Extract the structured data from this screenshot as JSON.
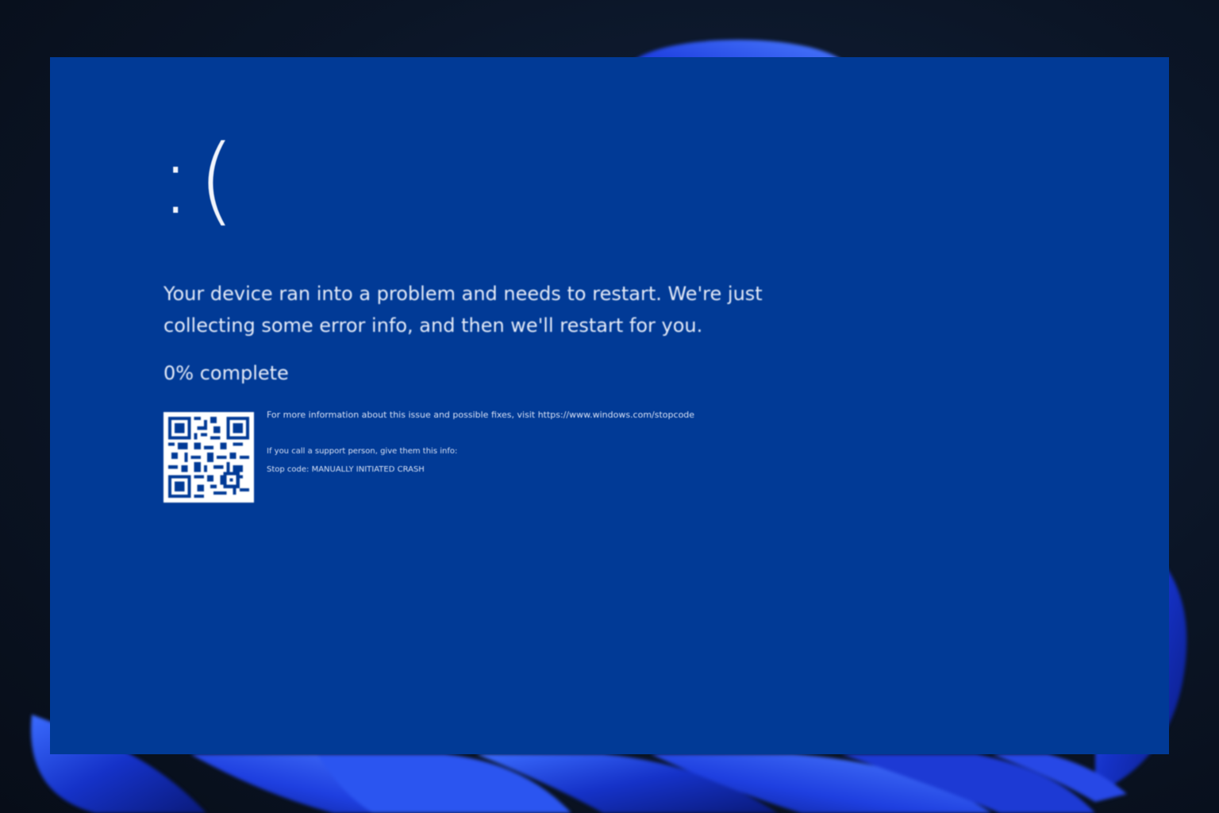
{
  "screen": {
    "background_color": "#013a96",
    "text_color": "#e9eefb"
  },
  "error": {
    "face": ":(",
    "message": "Your device ran into a problem and needs to restart. We're just collecting some error info, and then we'll restart for you.",
    "progress_text": "0% complete",
    "progress_percent": 0,
    "more_info": "For more information about this issue and possible fixes, visit https://www.windows.com/stopcode",
    "support_line": "If you call a support person, give them this info:",
    "stop_code_line": "Stop code: MANUALLY INITIATED CRASH"
  },
  "icons": {
    "qr": "qr-code-icon"
  }
}
